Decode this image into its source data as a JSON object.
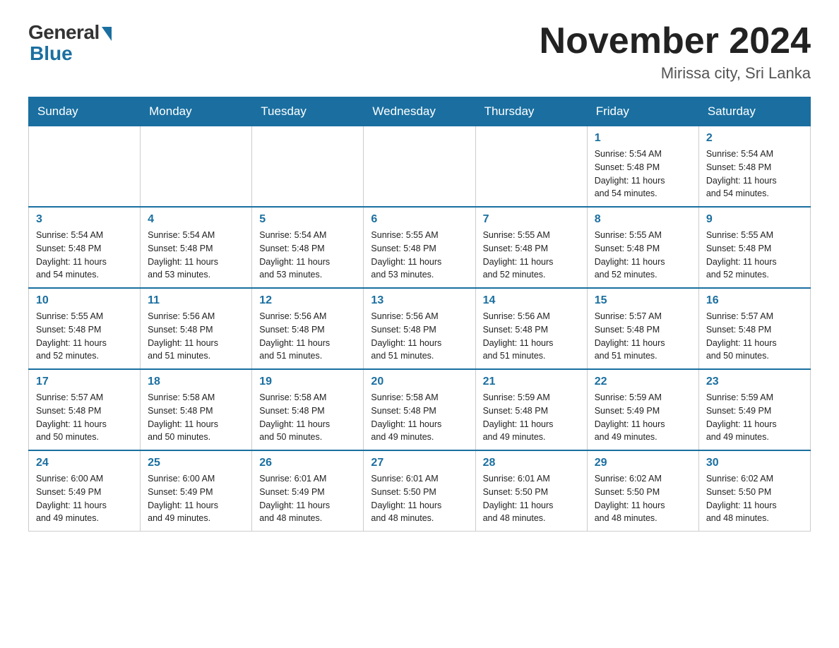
{
  "header": {
    "logo_general": "General",
    "logo_blue": "Blue",
    "month_year": "November 2024",
    "location": "Mirissa city, Sri Lanka"
  },
  "days_of_week": [
    "Sunday",
    "Monday",
    "Tuesday",
    "Wednesday",
    "Thursday",
    "Friday",
    "Saturday"
  ],
  "weeks": [
    [
      {
        "day": "",
        "info": ""
      },
      {
        "day": "",
        "info": ""
      },
      {
        "day": "",
        "info": ""
      },
      {
        "day": "",
        "info": ""
      },
      {
        "day": "",
        "info": ""
      },
      {
        "day": "1",
        "info": "Sunrise: 5:54 AM\nSunset: 5:48 PM\nDaylight: 11 hours\nand 54 minutes."
      },
      {
        "day": "2",
        "info": "Sunrise: 5:54 AM\nSunset: 5:48 PM\nDaylight: 11 hours\nand 54 minutes."
      }
    ],
    [
      {
        "day": "3",
        "info": "Sunrise: 5:54 AM\nSunset: 5:48 PM\nDaylight: 11 hours\nand 54 minutes."
      },
      {
        "day": "4",
        "info": "Sunrise: 5:54 AM\nSunset: 5:48 PM\nDaylight: 11 hours\nand 53 minutes."
      },
      {
        "day": "5",
        "info": "Sunrise: 5:54 AM\nSunset: 5:48 PM\nDaylight: 11 hours\nand 53 minutes."
      },
      {
        "day": "6",
        "info": "Sunrise: 5:55 AM\nSunset: 5:48 PM\nDaylight: 11 hours\nand 53 minutes."
      },
      {
        "day": "7",
        "info": "Sunrise: 5:55 AM\nSunset: 5:48 PM\nDaylight: 11 hours\nand 52 minutes."
      },
      {
        "day": "8",
        "info": "Sunrise: 5:55 AM\nSunset: 5:48 PM\nDaylight: 11 hours\nand 52 minutes."
      },
      {
        "day": "9",
        "info": "Sunrise: 5:55 AM\nSunset: 5:48 PM\nDaylight: 11 hours\nand 52 minutes."
      }
    ],
    [
      {
        "day": "10",
        "info": "Sunrise: 5:55 AM\nSunset: 5:48 PM\nDaylight: 11 hours\nand 52 minutes."
      },
      {
        "day": "11",
        "info": "Sunrise: 5:56 AM\nSunset: 5:48 PM\nDaylight: 11 hours\nand 51 minutes."
      },
      {
        "day": "12",
        "info": "Sunrise: 5:56 AM\nSunset: 5:48 PM\nDaylight: 11 hours\nand 51 minutes."
      },
      {
        "day": "13",
        "info": "Sunrise: 5:56 AM\nSunset: 5:48 PM\nDaylight: 11 hours\nand 51 minutes."
      },
      {
        "day": "14",
        "info": "Sunrise: 5:56 AM\nSunset: 5:48 PM\nDaylight: 11 hours\nand 51 minutes."
      },
      {
        "day": "15",
        "info": "Sunrise: 5:57 AM\nSunset: 5:48 PM\nDaylight: 11 hours\nand 51 minutes."
      },
      {
        "day": "16",
        "info": "Sunrise: 5:57 AM\nSunset: 5:48 PM\nDaylight: 11 hours\nand 50 minutes."
      }
    ],
    [
      {
        "day": "17",
        "info": "Sunrise: 5:57 AM\nSunset: 5:48 PM\nDaylight: 11 hours\nand 50 minutes."
      },
      {
        "day": "18",
        "info": "Sunrise: 5:58 AM\nSunset: 5:48 PM\nDaylight: 11 hours\nand 50 minutes."
      },
      {
        "day": "19",
        "info": "Sunrise: 5:58 AM\nSunset: 5:48 PM\nDaylight: 11 hours\nand 50 minutes."
      },
      {
        "day": "20",
        "info": "Sunrise: 5:58 AM\nSunset: 5:48 PM\nDaylight: 11 hours\nand 49 minutes."
      },
      {
        "day": "21",
        "info": "Sunrise: 5:59 AM\nSunset: 5:48 PM\nDaylight: 11 hours\nand 49 minutes."
      },
      {
        "day": "22",
        "info": "Sunrise: 5:59 AM\nSunset: 5:49 PM\nDaylight: 11 hours\nand 49 minutes."
      },
      {
        "day": "23",
        "info": "Sunrise: 5:59 AM\nSunset: 5:49 PM\nDaylight: 11 hours\nand 49 minutes."
      }
    ],
    [
      {
        "day": "24",
        "info": "Sunrise: 6:00 AM\nSunset: 5:49 PM\nDaylight: 11 hours\nand 49 minutes."
      },
      {
        "day": "25",
        "info": "Sunrise: 6:00 AM\nSunset: 5:49 PM\nDaylight: 11 hours\nand 49 minutes."
      },
      {
        "day": "26",
        "info": "Sunrise: 6:01 AM\nSunset: 5:49 PM\nDaylight: 11 hours\nand 48 minutes."
      },
      {
        "day": "27",
        "info": "Sunrise: 6:01 AM\nSunset: 5:50 PM\nDaylight: 11 hours\nand 48 minutes."
      },
      {
        "day": "28",
        "info": "Sunrise: 6:01 AM\nSunset: 5:50 PM\nDaylight: 11 hours\nand 48 minutes."
      },
      {
        "day": "29",
        "info": "Sunrise: 6:02 AM\nSunset: 5:50 PM\nDaylight: 11 hours\nand 48 minutes."
      },
      {
        "day": "30",
        "info": "Sunrise: 6:02 AM\nSunset: 5:50 PM\nDaylight: 11 hours\nand 48 minutes."
      }
    ]
  ]
}
